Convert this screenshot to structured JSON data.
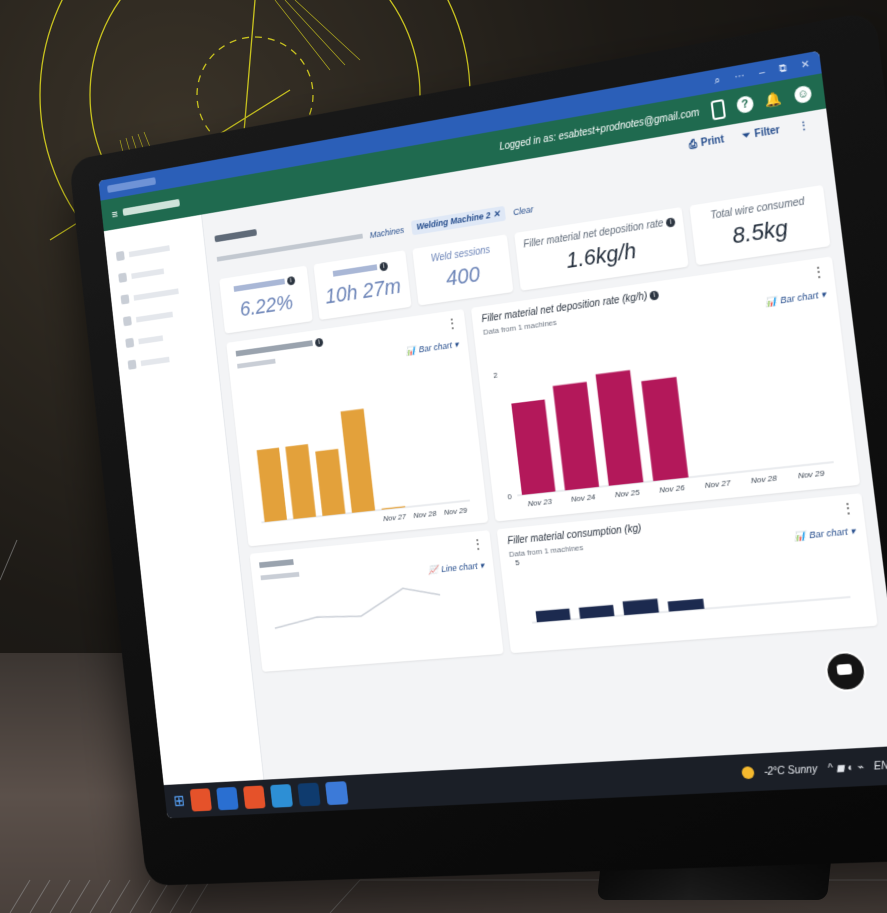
{
  "colors": {
    "appbar": "#1f6a4f",
    "titlebar": "#2b5fb8",
    "bar_orange": "#e3a13b",
    "bar_magenta": "#b3185a",
    "bar_navy": "#1c2a4f",
    "deco_yellow": "#c8c21f"
  },
  "window": {
    "search_icon": "search-icon",
    "more": "···",
    "minimize": "–",
    "restore": "⧉",
    "close": "✕"
  },
  "header": {
    "logged_in": "Logged in as: esabtest+prodnotes@gmail.com",
    "icons": [
      "phone-icon",
      "help-icon",
      "bell-icon",
      "account-icon"
    ]
  },
  "toolbar": {
    "print": "Print",
    "filter": "Filter",
    "more": "⋮"
  },
  "filter": {
    "chip": "Welding Machine 2",
    "chip_close": "✕",
    "clear": "Clear",
    "machines_label": "Machines"
  },
  "kpis": [
    {
      "label": "",
      "value": "6.22%"
    },
    {
      "label": "",
      "value": "10h 27m"
    },
    {
      "label": "Weld sessions",
      "value": "400"
    },
    {
      "label": "Filler material net deposition rate",
      "value": "1.6kg/h"
    },
    {
      "label": "Total wire consumed",
      "value": "8.5kg"
    }
  ],
  "cards": {
    "left_top": {
      "selector": "Bar chart",
      "x_labels": [
        "",
        "",
        "",
        "",
        "Nov 27",
        "Nov 28",
        "Nov 29"
      ]
    },
    "right_top": {
      "title": "Filler material net deposition rate (kg/h)",
      "subtitle": "Data from 1 machines",
      "selector": "Bar chart"
    },
    "left_bottom": {
      "selector": "Line chart"
    },
    "right_bottom": {
      "title": "Filler material consumption (kg)",
      "subtitle": "Data from 1 machines",
      "selector": "Bar chart"
    }
  },
  "chart_data": [
    {
      "type": "bar",
      "categories": [
        "",
        "",
        "",
        "",
        "Nov 27",
        "Nov 28",
        "Nov 29"
      ],
      "values": [
        0.62,
        0.62,
        0.55,
        0.86,
        0.01,
        0,
        0
      ],
      "ylim": [
        0,
        1
      ]
    },
    {
      "type": "bar",
      "title": "Filler material net deposition rate (kg/h)",
      "categories": [
        "Nov 23",
        "Nov 24",
        "Nov 25",
        "Nov 26",
        "Nov 27",
        "Nov 28",
        "Nov 29"
      ],
      "values": [
        1.5,
        1.7,
        1.8,
        1.6,
        0,
        0,
        0
      ],
      "ylim": [
        0,
        2
      ],
      "yticks": [
        "0",
        "2"
      ]
    },
    {
      "type": "bar",
      "title": "Filler material consumption (kg)",
      "categories": [
        "",
        "",
        "",
        "",
        "",
        "",
        ""
      ],
      "values": [
        0.9,
        0.9,
        1.1,
        0.8,
        0,
        0,
        0
      ],
      "ylim": [
        0,
        5
      ],
      "yticks": [
        "5"
      ]
    }
  ],
  "taskbar": {
    "weather": "-2°C Sunny",
    "lang": "ENG"
  }
}
